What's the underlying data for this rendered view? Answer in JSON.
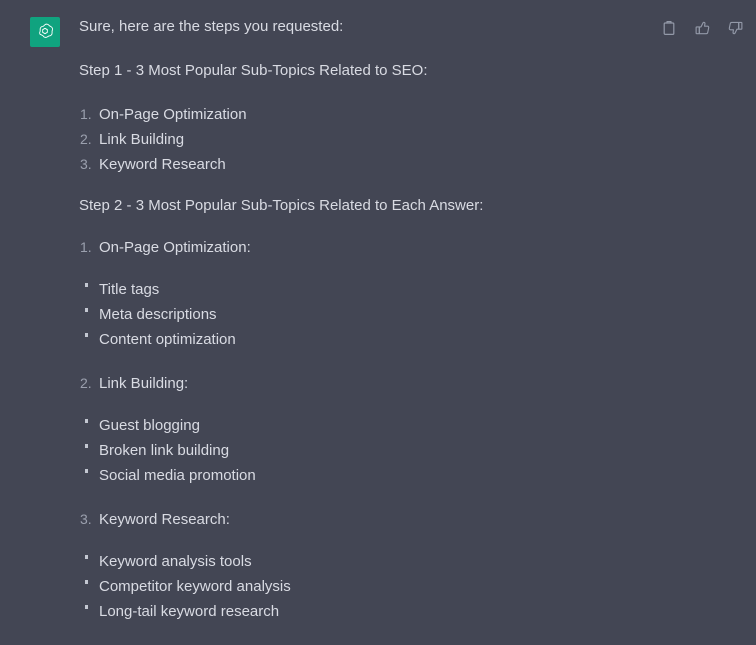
{
  "theme": {
    "background": "#434654",
    "text_color": "#d9dbe3",
    "marker_color": "#9ba0ae",
    "avatar_background": "#10a37f"
  },
  "message": {
    "avatar_icon": "openai-logo-icon",
    "intro": "Sure, here are the steps you requested:",
    "step1_heading": "Step 1 - 3 Most Popular Sub-Topics Related to SEO:",
    "step1_items": [
      "On-Page Optimization",
      "Link Building",
      "Keyword Research"
    ],
    "step2_heading": "Step 2 - 3 Most Popular Sub-Topics Related to Each Answer:",
    "step2_groups": [
      {
        "number": "1.",
        "heading": "On-Page Optimization:",
        "items": [
          "Title tags",
          "Meta descriptions",
          "Content optimization"
        ]
      },
      {
        "number": "2.",
        "heading": "Link Building:",
        "items": [
          "Guest blogging",
          "Broken link building",
          "Social media promotion"
        ]
      },
      {
        "number": "3.",
        "heading": "Keyword Research:",
        "items": [
          "Keyword analysis tools",
          "Competitor keyword analysis",
          "Long-tail keyword research"
        ]
      }
    ]
  },
  "actions": [
    {
      "name": "copy-icon",
      "label": "Copy"
    },
    {
      "name": "thumbs-up-icon",
      "label": "Good response"
    },
    {
      "name": "thumbs-down-icon",
      "label": "Bad response"
    }
  ]
}
